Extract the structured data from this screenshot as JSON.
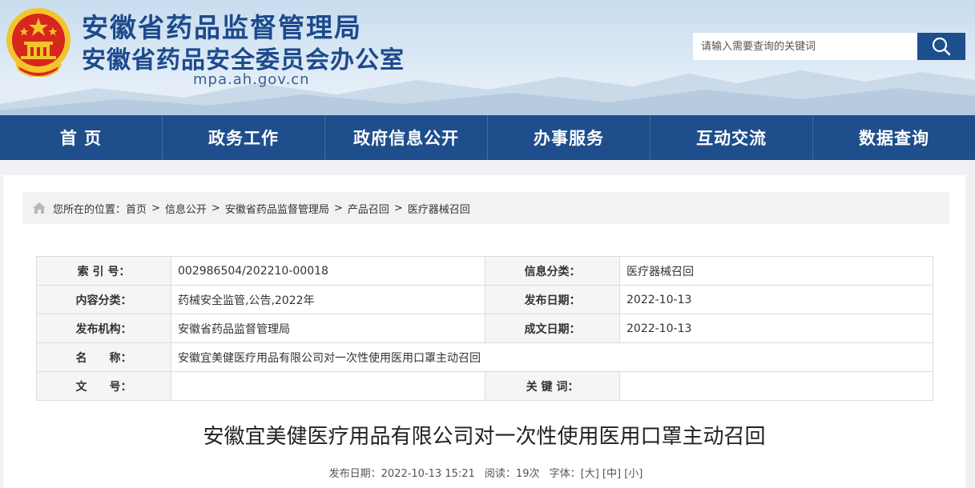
{
  "header": {
    "title": "安徽省药品监督管理局",
    "subtitle": "安徽省药品安全委员会办公室",
    "domain": "mpa.ah.gov.cn",
    "search_placeholder": "请输入需要查询的关键词",
    "search_icon": "search-icon",
    "emblem_icon": "national-emblem-icon"
  },
  "nav": {
    "items": [
      "首 页",
      "政务工作",
      "政府信息公开",
      "办事服务",
      "互动交流",
      "数据查询"
    ]
  },
  "breadcrumb": {
    "icon": "home-icon",
    "prefix": "您所在的位置：",
    "items": [
      "首页",
      "信息公开",
      "安徽省药品监督管理局",
      "产品召回",
      "医疗器械召回"
    ],
    "separator": ">"
  },
  "meta": {
    "index_label": "索 引 号：",
    "index_value": "002986504/202210-00018",
    "category_label": "信息分类：",
    "category_value": "医疗器械召回",
    "content_label": "内容分类：",
    "content_value": "药械安全监管,公告,2022年",
    "pub_date_label": "发布日期：",
    "pub_date_value": "2022-10-13",
    "org_label": "发布机构：",
    "org_value": "安徽省药品监督管理局",
    "doc_date_label": "成文日期：",
    "doc_date_value": "2022-10-13",
    "name_label": "名　　称：",
    "name_value": "安徽宜美健医疗用品有限公司对一次性使用医用口罩主动召回",
    "docno_label": "文　　号：",
    "docno_value": "",
    "keyword_label": "关 键 词：",
    "keyword_value": ""
  },
  "article": {
    "title": "安徽宜美健医疗用品有限公司对一次性使用医用口罩主动召回",
    "pub_label": "发布日期：2022-10-13 15:21",
    "reads": "阅读：19次",
    "font_label": "字体：",
    "font_large": "[大]",
    "font_medium": "[中]",
    "font_small": "[小]"
  },
  "colors": {
    "brand_blue": "#1f4e8c",
    "title_blue": "#1d4a8c",
    "emblem_red": "#d7261e",
    "emblem_gold": "#f2c52a"
  }
}
